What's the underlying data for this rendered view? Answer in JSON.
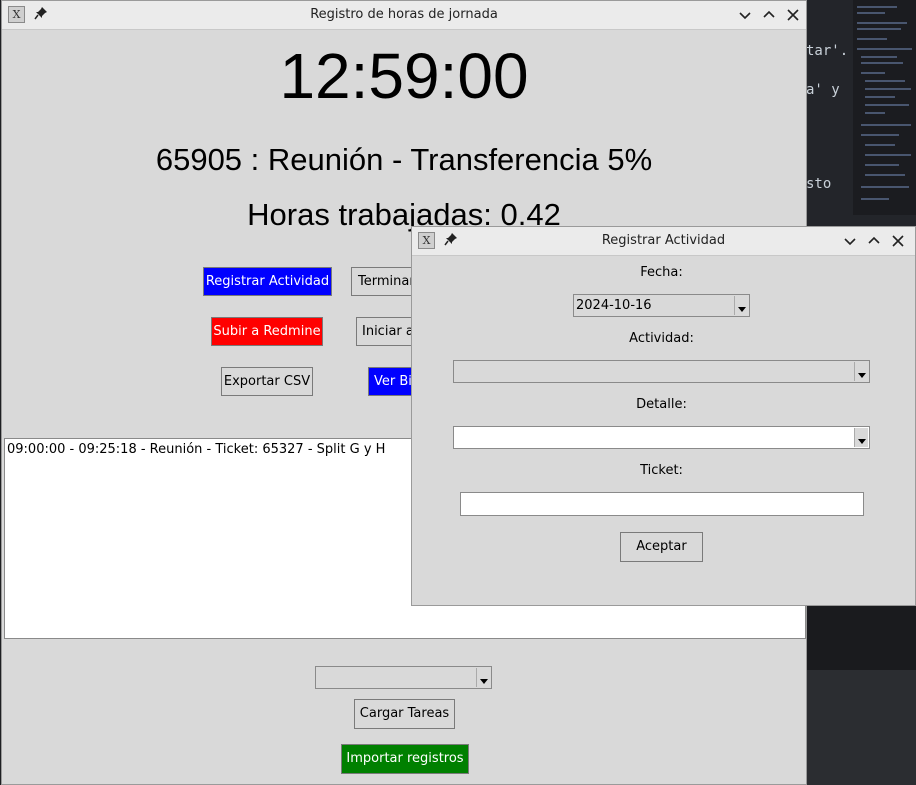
{
  "main_window": {
    "title": "Registro de horas de jornada",
    "clock": "12:59:00",
    "current_task": "65905 : Reunión - Transferencia 5%",
    "hours_worked": "Horas trabajadas: 0.42",
    "buttons": {
      "registrar": "Registrar Actividad",
      "terminar": "Terminar",
      "subir_redmine": "Subir a Redmine",
      "iniciar": "Iniciar a",
      "exportar_csv": "Exportar CSV",
      "ver_bitacora": "Ver Bit",
      "cargar_tareas": "Cargar Tareas",
      "importar": "Importar registros"
    },
    "log_entries": [
      "09:00:00 - 09:25:18 - Reunión - Ticket: 65327 - Split G y H"
    ],
    "task_combo_value": ""
  },
  "dialog": {
    "title": "Registrar Actividad",
    "fecha_label": "Fecha:",
    "fecha_value": "2024-10-16",
    "actividad_label": "Actividad:",
    "actividad_value": "",
    "detalle_label": "Detalle:",
    "detalle_value": "",
    "ticket_label": "Ticket:",
    "ticket_value": "",
    "aceptar": "Aceptar"
  },
  "background_editor": {
    "fragments": [
      "tar'.",
      "a' y",
      "sto"
    ]
  },
  "colors": {
    "blue_button": "#0000ff",
    "red_button": "#ff0000",
    "green_button": "#008000",
    "window_bg": "#d9d9d9"
  },
  "icons": [
    "app-icon",
    "pin-icon",
    "minimize-icon",
    "maximize-icon",
    "close-icon",
    "dropdown-arrow-icon"
  ]
}
